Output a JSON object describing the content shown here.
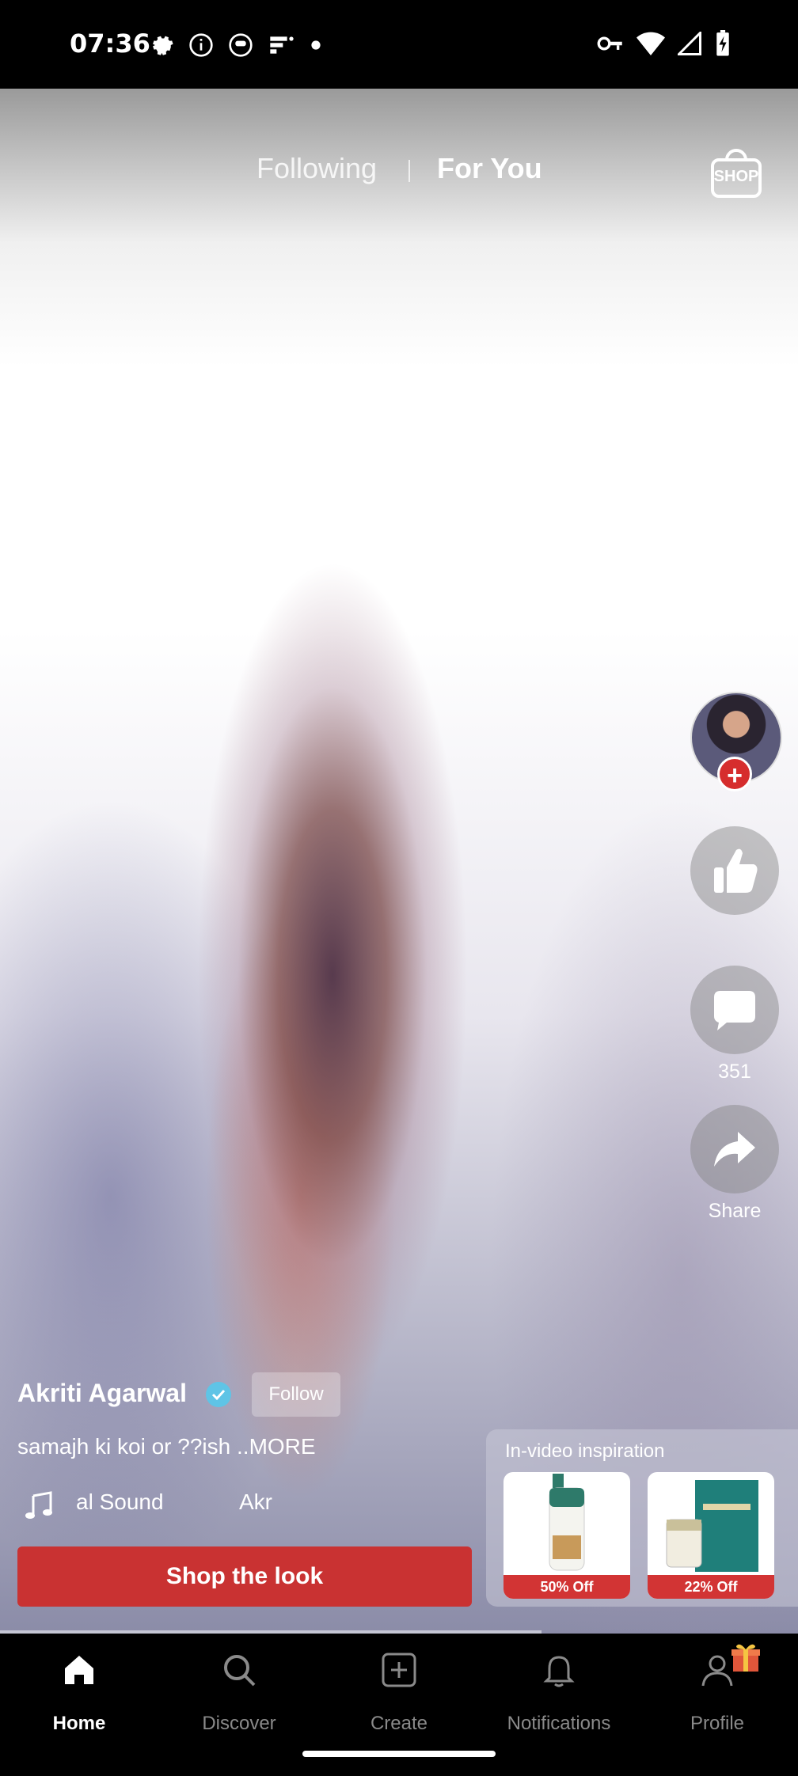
{
  "status_bar": {
    "time": "07:36"
  },
  "top_nav": {
    "tabs": [
      "Following",
      "For You"
    ],
    "shop_label": "SHOP"
  },
  "actions": {
    "comment_count": "351",
    "share_label": "Share"
  },
  "post": {
    "username": "Akriti Agarwal",
    "follow_label": "Follow",
    "caption": "samajh ki koi or ??ish ..MORE",
    "sound_a": "al Sound",
    "sound_b": "Akr"
  },
  "shop_look_label": "Shop the look",
  "inspiration": {
    "title": "In-video inspiration",
    "products": [
      {
        "discount": "50% Off"
      },
      {
        "discount": "22% Off"
      }
    ]
  },
  "bottom_nav": {
    "items": [
      "Home",
      "Discover",
      "Create",
      "Notifications",
      "Profile"
    ]
  },
  "colors": {
    "accent_red": "#d62d2d",
    "verified_blue": "#5fc4e6"
  }
}
